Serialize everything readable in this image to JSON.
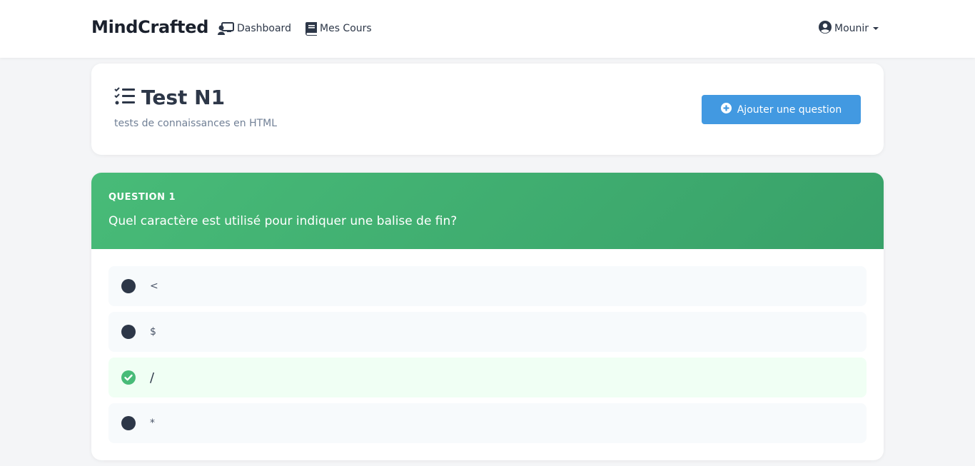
{
  "nav": {
    "brand": "MindCrafted",
    "dashboard_label": "Dashboard",
    "cours_label": "Mes Cours",
    "user_label": "Mounir"
  },
  "test": {
    "title": "Test N1",
    "description": "tests de connaissances en HTML",
    "add_button_label": "Ajouter une question"
  },
  "question": {
    "label": "QUESTION 1",
    "text": "Quel caractère est utilisé pour indiquer une balise de fin?",
    "answers": [
      {
        "text": "<",
        "correct": false
      },
      {
        "text": "$",
        "correct": false
      },
      {
        "text": "/",
        "correct": true
      },
      {
        "text": "*",
        "correct": false
      }
    ]
  },
  "colors": {
    "accent_blue": "#4299e1",
    "success_green": "#48bb78",
    "text_dark": "#2d3748"
  },
  "icons": {
    "dashboard": "chalkboard-teacher-icon",
    "cours": "book-icon",
    "user": "user-circle-icon",
    "tasks": "tasks-list-icon",
    "add": "plus-circle-icon",
    "correct": "check-circle-icon"
  }
}
